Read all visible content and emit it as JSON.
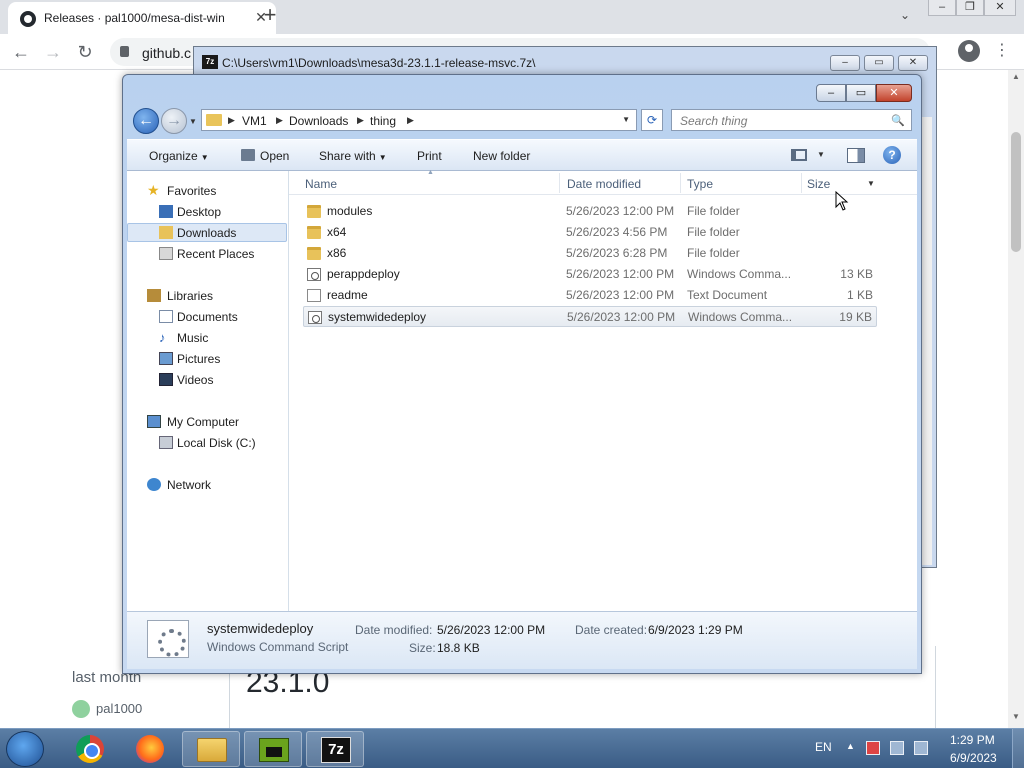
{
  "browser": {
    "tab_title": "Releases · pal1000/mesa-dist-win",
    "tab_close": "✕",
    "new_tab": "+",
    "url": "github.c",
    "menu": "⋮",
    "page": {
      "sidebar_label": "last month",
      "user": "pal1000",
      "release_heading": "23.1.0"
    }
  },
  "sevenzip": {
    "title": "C:\\Users\\vm1\\Downloads\\mesa3d-23.1.1-release-msvc.7z\\"
  },
  "explorer": {
    "breadcrumbs": [
      "VM1",
      "Downloads",
      "thing"
    ],
    "search_placeholder": "Search thing",
    "commands": {
      "organize": "Organize",
      "open": "Open",
      "share_with": "Share with",
      "print": "Print",
      "new_folder": "New folder"
    },
    "nav": {
      "favorites": "Favorites",
      "desktop": "Desktop",
      "downloads": "Downloads",
      "recent_places": "Recent Places",
      "libraries": "Libraries",
      "documents": "Documents",
      "music": "Music",
      "pictures": "Pictures",
      "videos": "Videos",
      "my_computer": "My Computer",
      "local_disk": "Local Disk (C:)",
      "network": "Network"
    },
    "columns": {
      "name": "Name",
      "date_modified": "Date modified",
      "type": "Type",
      "size": "Size"
    },
    "files": [
      {
        "name": "modules",
        "date": "5/26/2023 12:00 PM",
        "type": "File folder",
        "size": "",
        "icon": "folder-icon"
      },
      {
        "name": "x64",
        "date": "5/26/2023 4:56 PM",
        "type": "File folder",
        "size": "",
        "icon": "folder-icon"
      },
      {
        "name": "x86",
        "date": "5/26/2023 6:28 PM",
        "type": "File folder",
        "size": "",
        "icon": "folder-icon"
      },
      {
        "name": "perappdeploy",
        "date": "5/26/2023 12:00 PM",
        "type": "Windows Comma...",
        "size": "13 KB",
        "icon": "script-icon"
      },
      {
        "name": "readme",
        "date": "5/26/2023 12:00 PM",
        "type": "Text Document",
        "size": "1 KB",
        "icon": "text-file-icon"
      },
      {
        "name": "systemwidedeploy",
        "date": "5/26/2023 12:00 PM",
        "type": "Windows Comma...",
        "size": "19 KB",
        "icon": "script-icon"
      }
    ],
    "details": {
      "name": "systemwidedeploy",
      "type": "Windows Command Script",
      "date_modified_label": "Date modified:",
      "date_modified": "5/26/2023 12:00 PM",
      "date_created_label": "Date created:",
      "date_created": "6/9/2023 1:29 PM",
      "size_label": "Size:",
      "size": "18.8 KB"
    }
  },
  "taskbar": {
    "sevenzip_label": "7z",
    "language": "EN",
    "time": "1:29 PM",
    "date": "6/9/2023"
  },
  "colors": {
    "accent": "#2a63b8",
    "taskbar": "#3a5c85",
    "selection": "#dde8f6"
  }
}
